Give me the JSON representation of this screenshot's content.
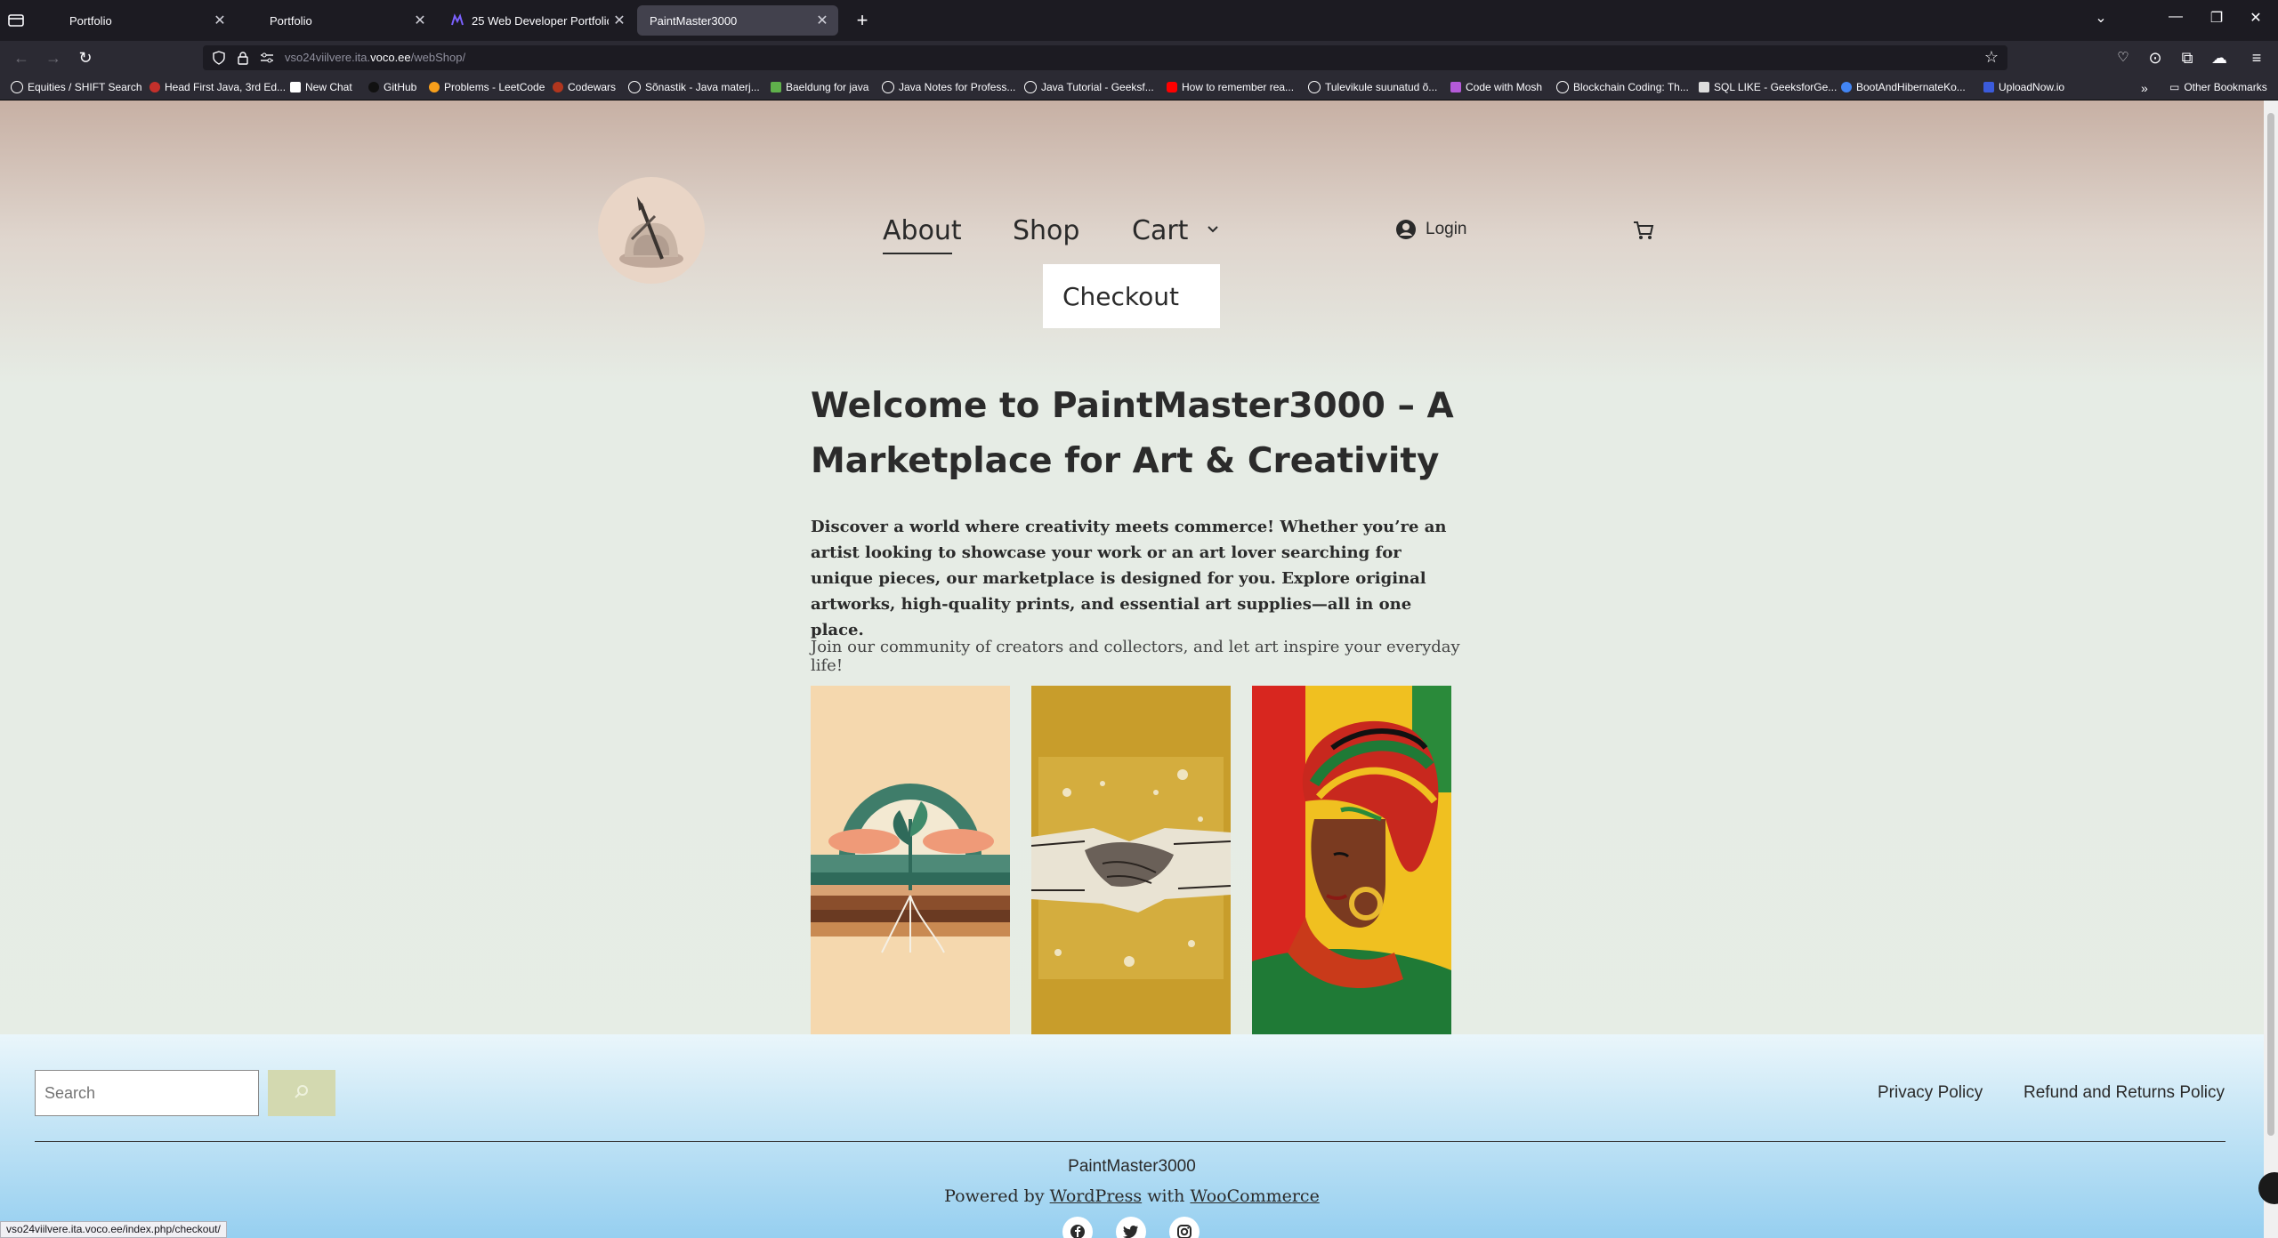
{
  "browser": {
    "tabs": [
      {
        "label": "Portfolio",
        "active": false
      },
      {
        "label": "Portfolio",
        "active": false
      },
      {
        "label": "25 Web Developer Portfolio Exa",
        "active": false
      },
      {
        "label": "PaintMaster3000",
        "active": true
      }
    ],
    "url_prefix": "vso24viilvere.ita.",
    "url_domain": "voco.ee",
    "url_path": "/webShop/",
    "bookmarks": [
      "Equities / SHIFT Search",
      "Head First Java, 3rd Ed...",
      "New Chat",
      "GitHub",
      "Problems - LeetCode",
      "Codewars",
      "Sõnastik - Java materj...",
      "Baeldung for java",
      "Java Notes for Profess...",
      "Java Tutorial - Geeksf...",
      "How to remember rea...",
      "Tulevikule suunatud õ...",
      "Code with Mosh",
      "Blockchain Coding: Th...",
      "SQL LIKE - GeeksforGe...",
      "BootAndHibernateKo...",
      "UploadNow.io"
    ],
    "other_bookmarks": "Other Bookmarks",
    "status_url": "vso24viilvere.ita.voco.ee/index.php/checkout/"
  },
  "site": {
    "nav": {
      "about": "About",
      "shop": "Shop",
      "cart": "Cart",
      "checkout": "Checkout",
      "login": "Login"
    },
    "headline": "Welcome to PaintMaster3000 – A Marketplace for Art & Creativity",
    "intro": "Discover a world where creativity meets commerce! Whether you’re an artist looking to showcase your work or an art lover searching for unique pieces, our marketplace is designed for you. Explore original artworks, high-quality prints, and essential art supplies—all in one place.",
    "join": "Join our community of creators and collectors, and let art inspire your everyday life!",
    "footer": {
      "search_placeholder": "Search",
      "privacy": "Privacy Policy",
      "refund": "Refund and Returns Policy",
      "site_name": "PaintMaster3000",
      "powered_prefix": "Powered by",
      "wordpress": "WordPress",
      "with": "with",
      "woocommerce": "WooCommerce"
    }
  },
  "colors": {
    "accent_button": "#d3d9b0",
    "text_dark": "#2b2b2b"
  }
}
